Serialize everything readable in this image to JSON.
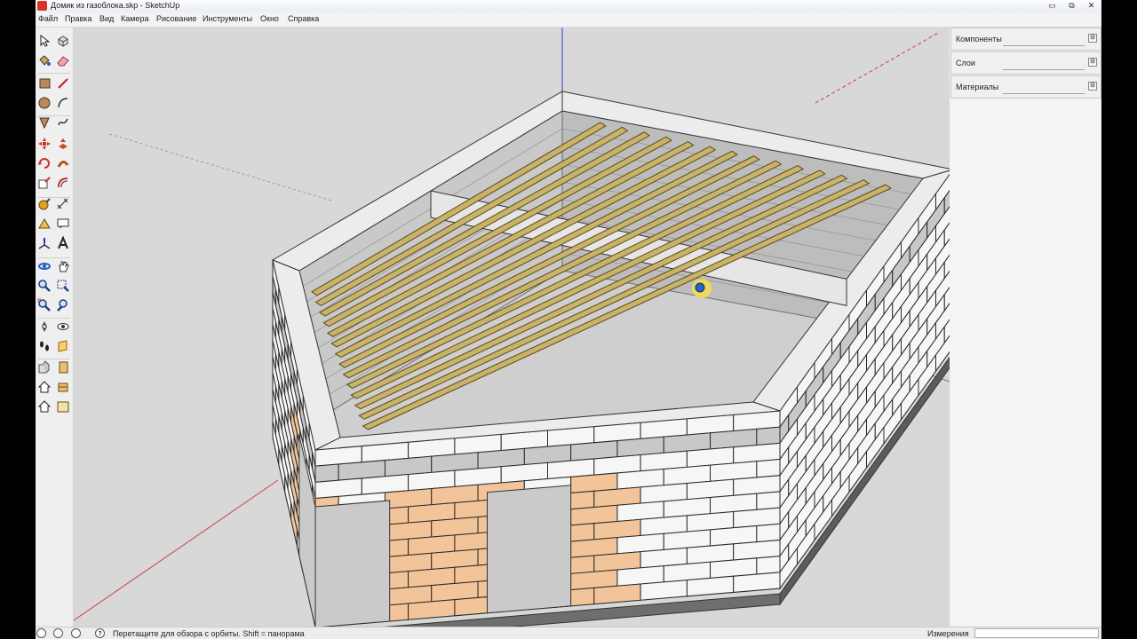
{
  "window": {
    "title": "Домик из газоблока.skp - SketchUp",
    "controls": {
      "minimize": "▭",
      "maximize": "⧉",
      "close": "✕"
    }
  },
  "menu": {
    "items": [
      "Файл",
      "Правка",
      "Вид",
      "Камера",
      "Рисование",
      "Инструменты",
      "Окно",
      "Справка"
    ]
  },
  "toolbar": {
    "tools": [
      "select-icon",
      "make-component-icon",
      "paint-bucket-icon",
      "eraser-icon",
      "rectangle-icon",
      "line-icon",
      "circle-icon",
      "arc-icon",
      "polygon-icon",
      "freehand-icon",
      "move-icon",
      "push-pull-icon",
      "rotate-icon",
      "follow-me-icon",
      "scale-icon",
      "offset-icon",
      "tape-measure-icon",
      "dimension-icon",
      "protractor-icon",
      "text-icon",
      "axes-icon",
      "3d-text-icon",
      "orbit-icon",
      "pan-icon",
      "zoom-icon",
      "zoom-window-icon",
      "zoom-extents-icon",
      "previous-view-icon",
      "position-camera-icon",
      "look-around-icon",
      "walk-icon",
      "section-plane-icon",
      "get-models-icon",
      "share-model-icon",
      "warehouse-icon",
      "share-component-icon",
      "home-icon",
      "extension-icon"
    ]
  },
  "tray": {
    "panels": [
      {
        "title": "Компоненты",
        "toggle": "⊞"
      },
      {
        "title": "Слои",
        "toggle": "⊞"
      },
      {
        "title": "Материалы",
        "toggle": "⊞"
      }
    ]
  },
  "status": {
    "icons": [
      "geo-location-icon",
      "credits-icon",
      "user-icon"
    ],
    "help_icon": "?",
    "text": "Перетащите для обзора с орбиты. Shift = панорама",
    "measure_label": "Измерения",
    "measure_value": ""
  },
  "colors": {
    "viewport_bg": "#d8d8d8",
    "block_white": "#f6f6f6",
    "block_orange": "#f2c49a",
    "joist_wood": "#c9b26a",
    "axis_red": "#d04040",
    "axis_green": "#3aa040",
    "axis_blue": "#3040d0"
  }
}
